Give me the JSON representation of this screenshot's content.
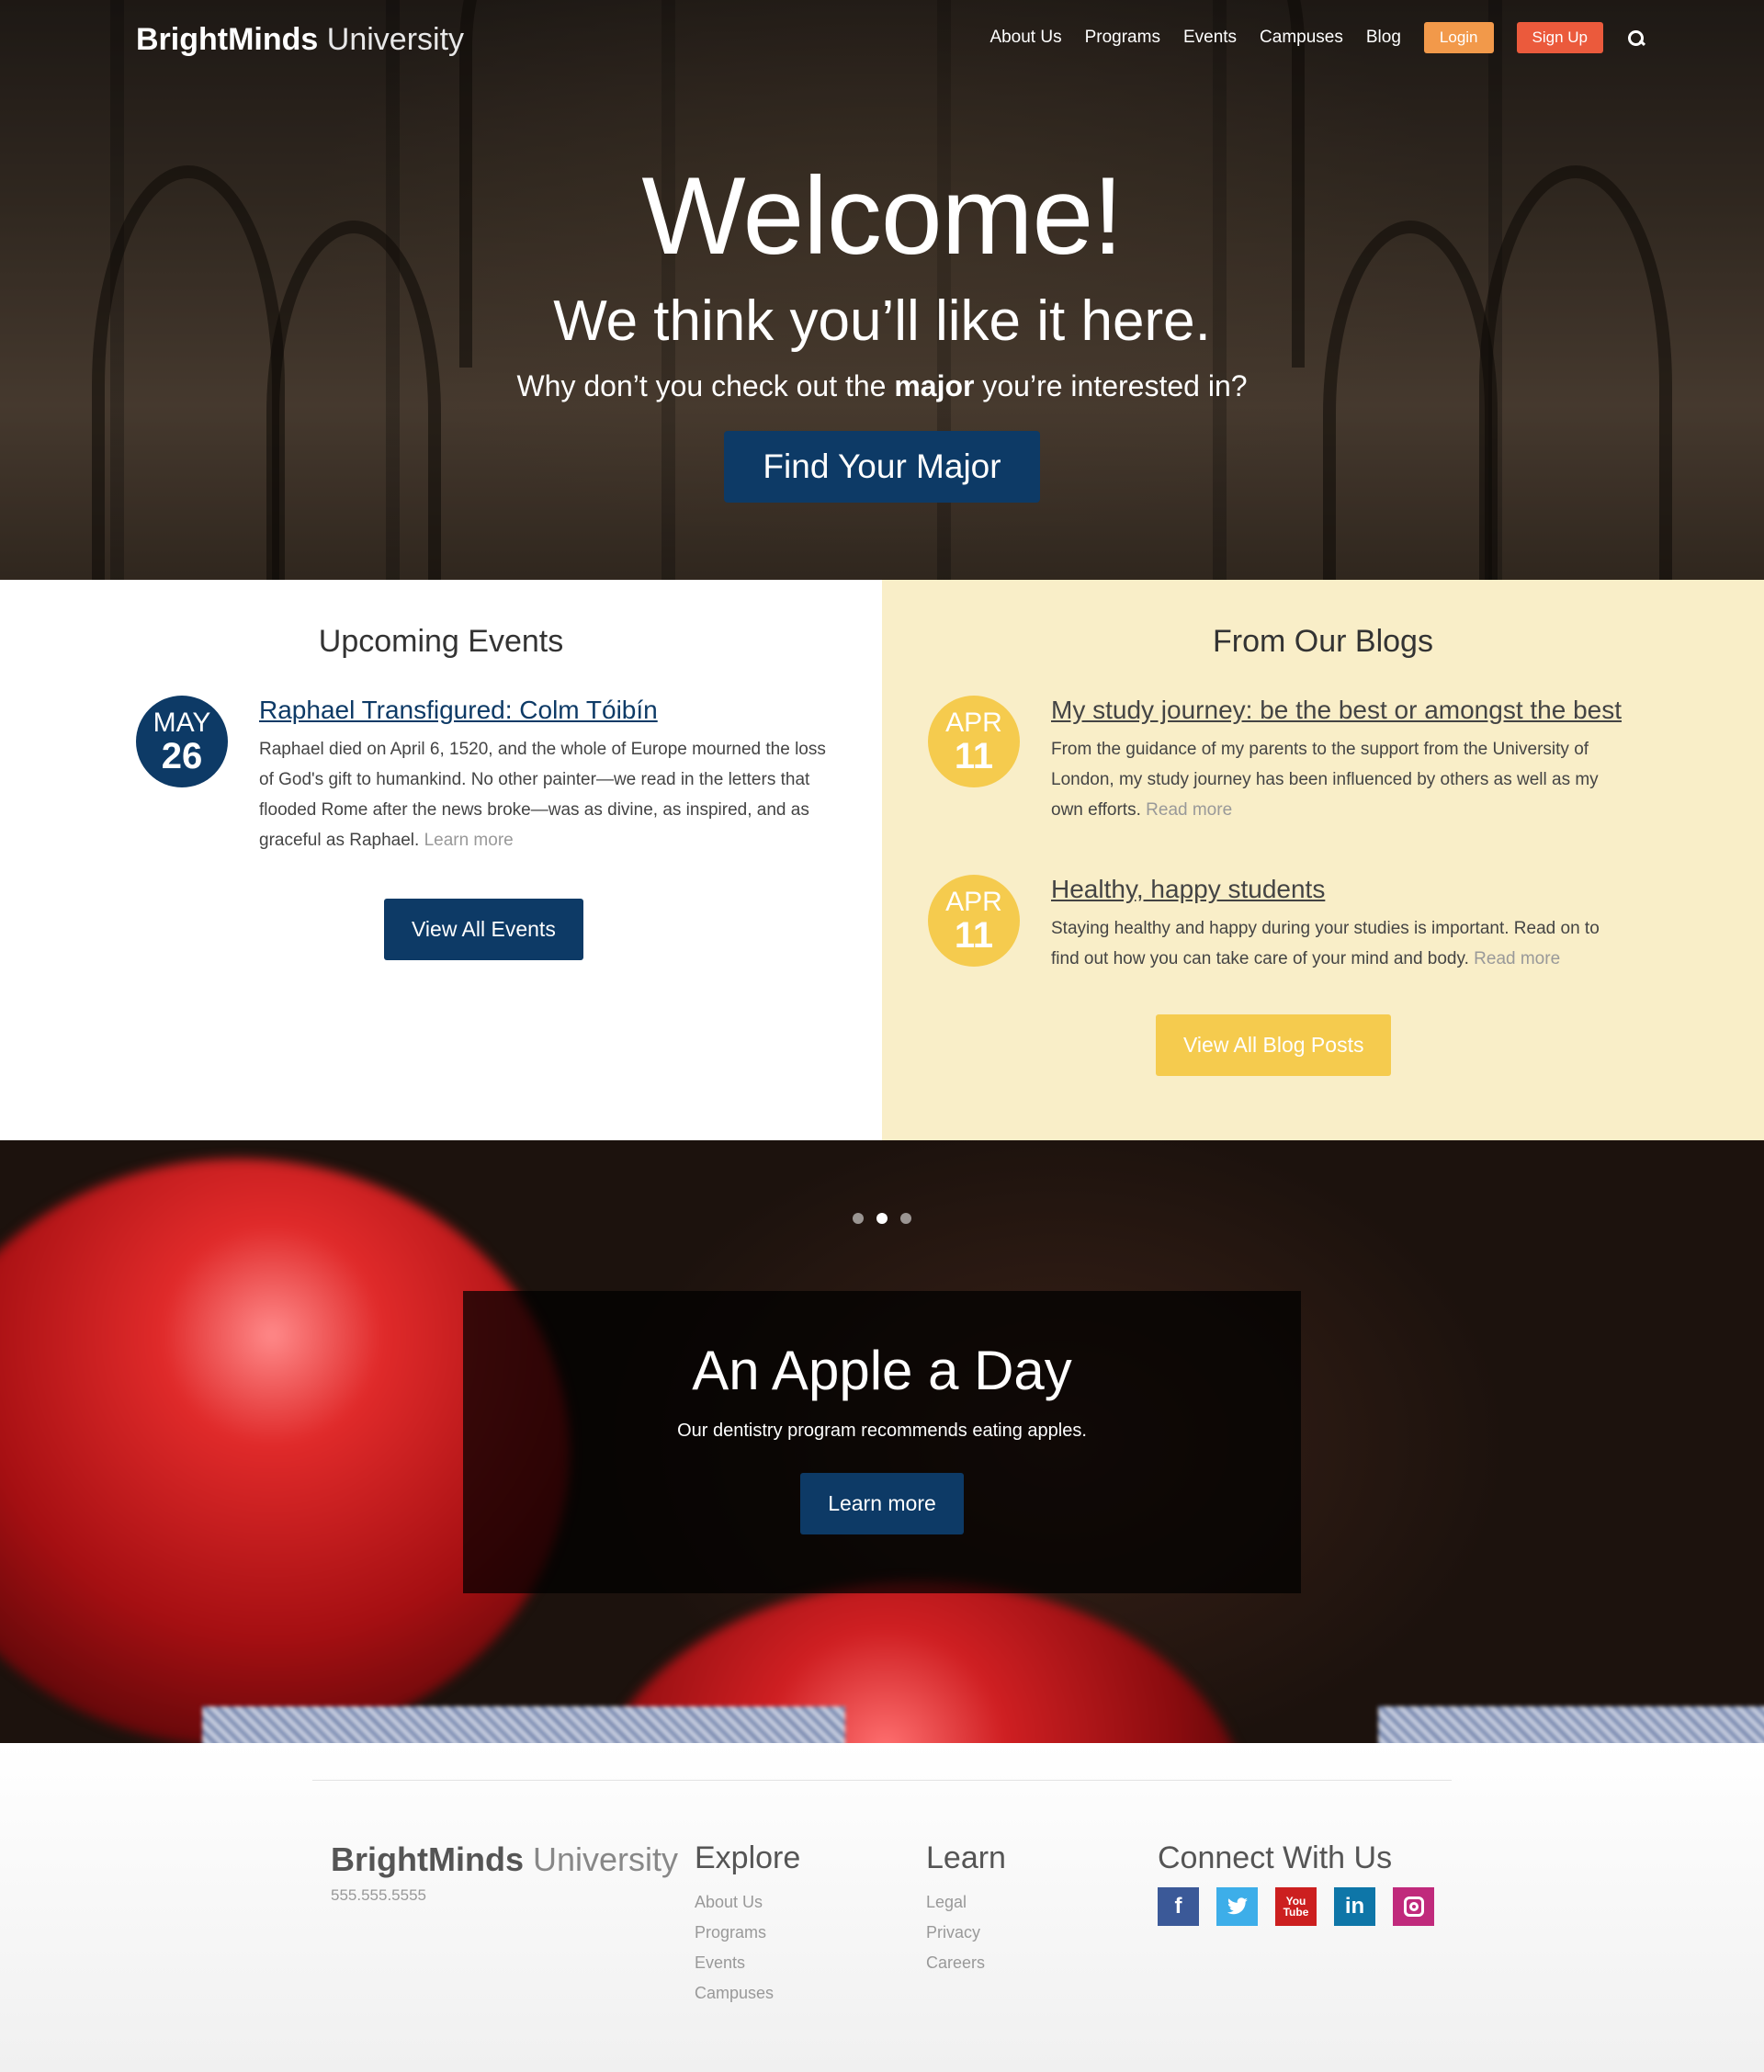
{
  "nav": {
    "brand_bold": "BrightMinds",
    "brand_light": "University",
    "links": [
      "About Us",
      "Programs",
      "Events",
      "Campuses",
      "Blog"
    ],
    "login": "Login",
    "signup": "Sign Up",
    "search_icon": "search-icon"
  },
  "hero": {
    "title": "Welcome!",
    "subtitle": "We think you’ll like it here.",
    "prompt_before": "Why don’t you check out the",
    "prompt_bold": "major",
    "prompt_after": "you’re interested in?",
    "cta": "Find Your Major"
  },
  "events": {
    "heading": "Upcoming Events",
    "items": [
      {
        "month": "MAY",
        "day": "26",
        "title": "Raphael Transfigured: Colm Tóibín",
        "text": "Raphael died on April 6, 1520, and the whole of Europe mourned the loss of God's gift to humankind. No other painter—we read in the letters that flooded Rome after the news broke—was as divine, as inspired, and as graceful as Raphael.",
        "more": "Learn more"
      }
    ],
    "button": "View All Events"
  },
  "blogs": {
    "heading": "From Our Blogs",
    "items": [
      {
        "month": "APR",
        "day": "11",
        "title": "My study journey: be the best or amongst the best",
        "text": "From the guidance of my parents to the support from the University of London, my study journey has been influenced by others as well as my own efforts.",
        "more": "Read more"
      },
      {
        "month": "APR",
        "day": "11",
        "title": "Healthy, happy students",
        "text": "Staying healthy and happy during your studies is important. Read on to find out how you can take care of your mind and body.",
        "more": "Read more"
      }
    ],
    "button": "View All Blog Posts"
  },
  "slider": {
    "dots": 3,
    "active_dot": 2,
    "title": "An Apple a Day",
    "text": "Our dentistry program recommends eating apples.",
    "button": "Learn more"
  },
  "footer": {
    "brand_bold": "BrightMinds",
    "brand_light": "University",
    "phone": "555.555.5555",
    "explore_heading": "Explore",
    "explore_links": [
      "About Us",
      "Programs",
      "Events",
      "Campuses"
    ],
    "learn_heading": "Learn",
    "learn_links": [
      "Legal",
      "Privacy",
      "Careers"
    ],
    "connect_heading": "Connect With Us",
    "socials": [
      "facebook-icon",
      "twitter-icon",
      "youtube-icon",
      "linkedin-icon",
      "instagram-icon"
    ]
  },
  "colors": {
    "navy": "#0d3a66",
    "login_orange": "#f2994a",
    "signup_red": "#eb5a3c",
    "blog_bg": "#f9eec8",
    "blog_yellow": "#f5cb4e"
  }
}
